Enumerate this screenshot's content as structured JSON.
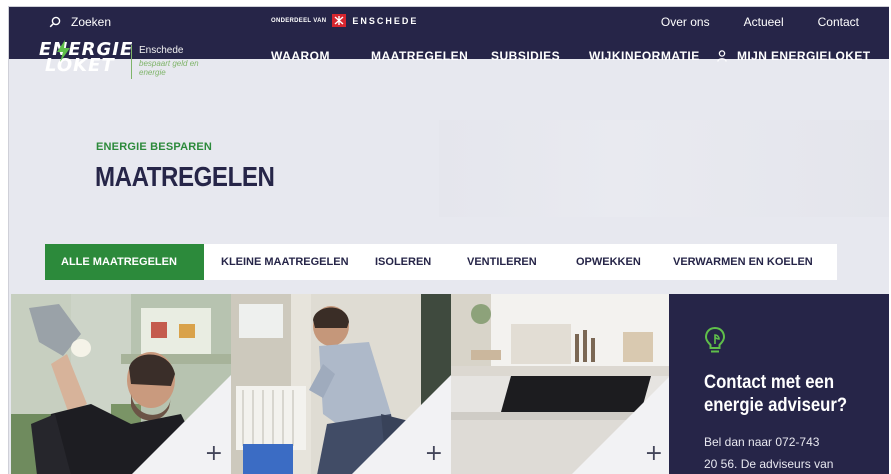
{
  "header": {
    "search_label": "Zoeken",
    "logo": {
      "line1": "ENERGIE",
      "line2": "LOKET",
      "city": "Enschede",
      "tagline": "bespaart geld en energie"
    },
    "part_of": {
      "label": "ONDERDEEL VAN",
      "city": "ENSCHEDE"
    },
    "top_links": [
      "Over ons",
      "Actueel",
      "Contact"
    ],
    "main_nav": [
      "WAAROM",
      "MAATREGELEN",
      "SUBSIDIES",
      "WIJKINFORMATIE"
    ],
    "user_link": "MIJN ENERGIELOKET"
  },
  "hero": {
    "eyebrow": "ENERGIE BESPAREN",
    "title": "MAATREGELEN"
  },
  "tabs": [
    {
      "label": "ALLE MAATREGELEN",
      "active": true
    },
    {
      "label": "KLEINE MAATREGELEN",
      "active": false
    },
    {
      "label": "ISOLEREN",
      "active": false
    },
    {
      "label": "VENTILEREN",
      "active": false
    },
    {
      "label": "OPWEKKEN",
      "active": false
    },
    {
      "label": "VERWARMEN EN KOELEN",
      "active": false
    }
  ],
  "cards": [
    {
      "icon": "plus-icon",
      "symbol": "+"
    },
    {
      "icon": "plus-icon",
      "symbol": "+"
    },
    {
      "icon": "plus-icon",
      "symbol": "+"
    }
  ],
  "contact": {
    "title": "Contact met een energie adviseur?",
    "text": "Bel dan naar 072-743",
    "text2": "20 56. De adviseurs van"
  },
  "colors": {
    "navy": "#262548",
    "green": "#2c8a3b",
    "accent_red": "#d6262f"
  }
}
